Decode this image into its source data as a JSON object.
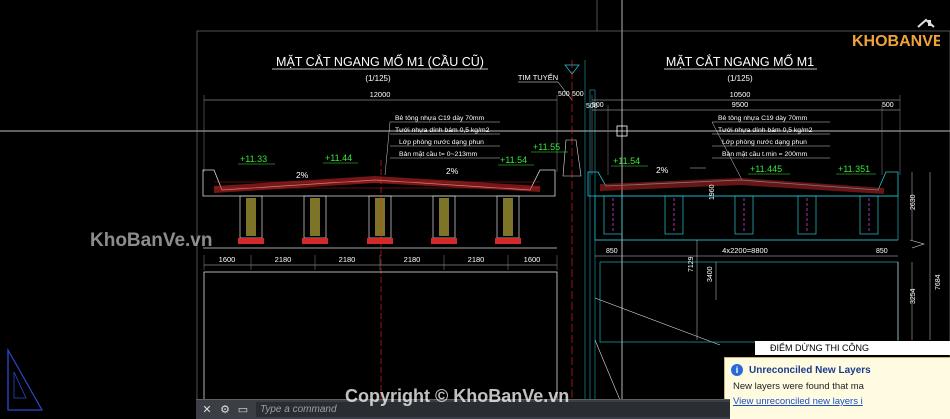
{
  "drawing": {
    "left_section": {
      "title": "MẶT CẮT NGANG MỐ M1 (CẦU CŨ)",
      "scale": "(1/125)",
      "overall_dim": "12000",
      "levels": [
        "+11.33",
        "+11.44",
        "+11.54",
        "+11.55"
      ],
      "slope_left": "2%",
      "slope_right": "2%",
      "bottom_dims": [
        "1600",
        "2180",
        "2180",
        "2180",
        "2180",
        "1600"
      ],
      "layers": [
        "Bê tông nhựa C19 dày 70mm",
        "Tưới nhựa dính bám 0,5 kg/m2",
        "Lớp phòng nước dạng phun",
        "Bản mặt cầu t= 0~213mm"
      ]
    },
    "centerline_label": "TIM TUYẾN",
    "center_dims": [
      "500",
      "500",
      "500"
    ],
    "right_section": {
      "title": "MẶT CẮT NGANG MỐ M1",
      "scale": "(1/125)",
      "overall_dim": "10500",
      "inner_dim": "9500",
      "edge_dim_left": "500",
      "edge_dim_right": "500",
      "levels": [
        "+11.54",
        "+11.445",
        "+11.351"
      ],
      "slope": "2%",
      "layers": [
        "Bê tông nhựa C19 dày 70mm",
        "Tưới nhựa dính bám 0,5 kg/m2",
        "Lớp phòng nước dạng phun",
        "Bản mặt cầu t.min = 200mm"
      ],
      "girder_dim": "4x2200=8800",
      "side_dim_left": "850",
      "side_dim_right": "850",
      "vertical_dims": [
        "1960",
        "2630",
        "7129",
        "3400",
        "3254",
        "7684"
      ]
    }
  },
  "status_label": "ĐIỂM DỪNG THI CÔNG",
  "notification": {
    "title": "Unreconciled New Layers",
    "body": "New layers were found that ma",
    "link": "View unreconciled new layers i"
  },
  "command_line": {
    "placeholder": "Type a command"
  },
  "watermarks": {
    "logo_text": "KHOBANVE",
    "left": "KhoBanVe.vn",
    "bottom": "Copyright © KhoBanVe.vn"
  },
  "colors": {
    "background": "#000000",
    "dim": "#ffffff",
    "level_green": "#39e639",
    "hatch_red": "#d22a2a",
    "pier_yellow": "#e6d44a",
    "cyan": "#22c9d6",
    "magenta": "#d23bd2",
    "red_line": "#ff2020"
  }
}
